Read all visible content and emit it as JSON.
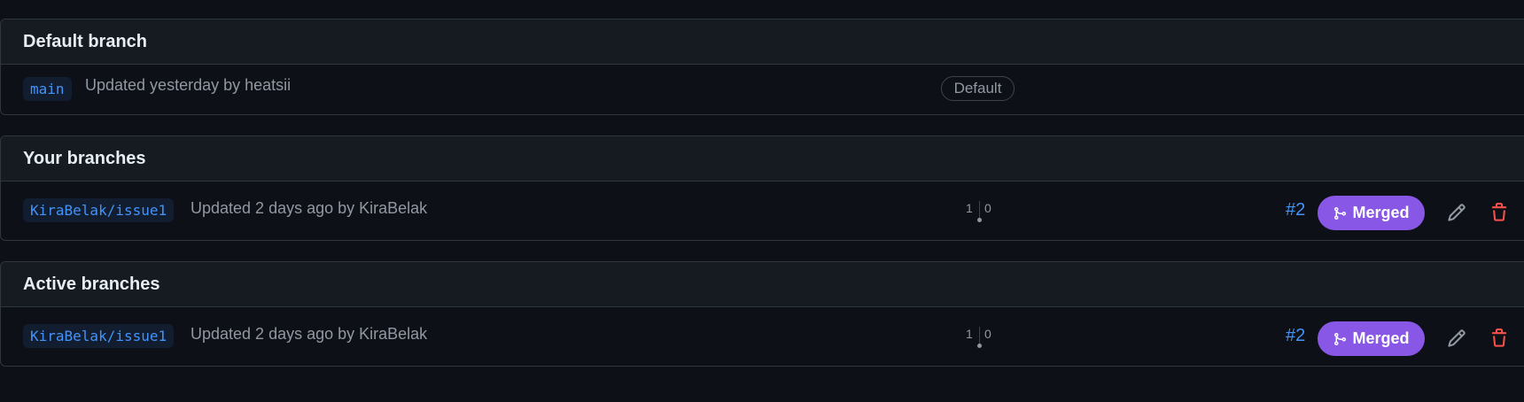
{
  "sections": [
    {
      "title": "Default branch",
      "rows": [
        {
          "branch": "main",
          "updated": "Updated yesterday by heatsii",
          "badge": "Default"
        }
      ]
    },
    {
      "title": "Your branches",
      "rows": [
        {
          "branch": "KiraBelak/issue1",
          "updated": "Updated 2 days ago by KiraBelak",
          "behind": "1",
          "ahead": "0",
          "pr_number": "#2",
          "pr_status": "Merged"
        }
      ]
    },
    {
      "title": "Active branches",
      "rows": [
        {
          "branch": "KiraBelak/issue1",
          "updated": "Updated 2 days ago by KiraBelak",
          "behind": "1",
          "ahead": "0",
          "pr_number": "#2",
          "pr_status": "Merged"
        }
      ]
    }
  ],
  "icons": {
    "merge": "git-merge-icon",
    "edit": "pencil-icon",
    "delete": "trash-icon"
  },
  "colors": {
    "background": "#0d1117",
    "header": "#161b22",
    "border": "#30363d",
    "link": "#4493f8",
    "merged": "#8957e5",
    "delete": "#f85149",
    "muted": "#9198a1"
  }
}
